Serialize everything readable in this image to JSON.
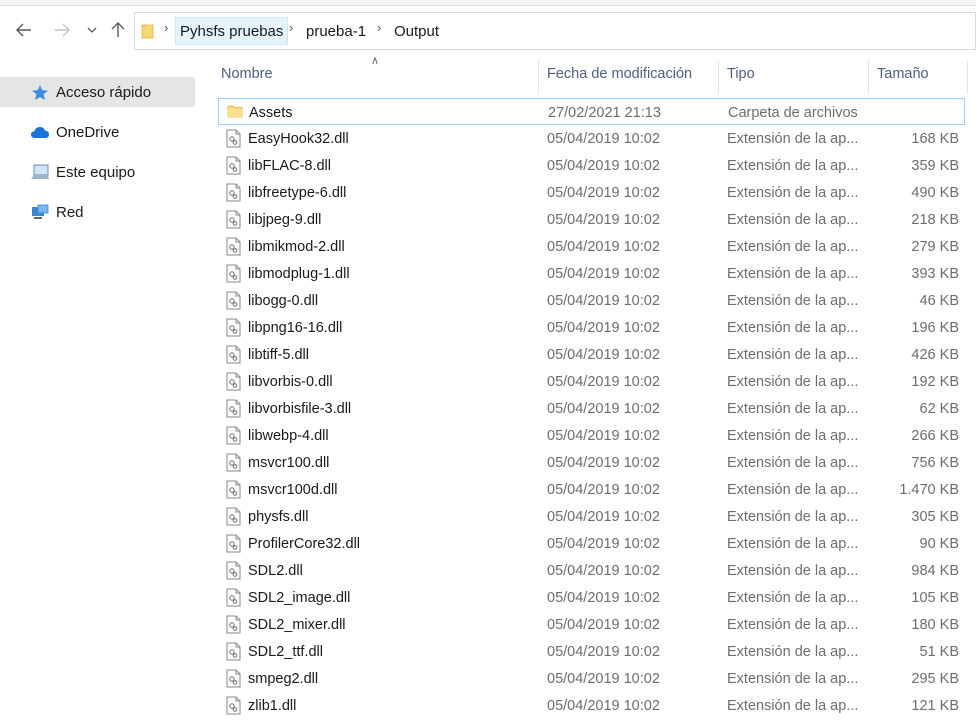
{
  "nav": {
    "back_icon": "back-arrow-icon",
    "forward_icon": "forward-arrow-icon",
    "recent_icon": "chevron-down-icon",
    "up_icon": "up-arrow-icon",
    "breadcrumbs": [
      "Pyhsfs pruebas",
      "prueba-1",
      "Output"
    ]
  },
  "sidebar": {
    "items": [
      {
        "label": "Acceso rápido",
        "icon": "star-icon"
      },
      {
        "label": "OneDrive",
        "icon": "cloud-icon"
      },
      {
        "label": "Este equipo",
        "icon": "computer-icon"
      },
      {
        "label": "Red",
        "icon": "network-icon"
      }
    ]
  },
  "columns": {
    "name": "Nombre",
    "date": "Fecha de modificación",
    "type": "Tipo",
    "size": "Tamaño"
  },
  "files": [
    {
      "name": "Assets",
      "date": "27/02/2021 21:13",
      "type": "Carpeta de archivos",
      "size": "",
      "kind": "folder"
    },
    {
      "name": "EasyHook32.dll",
      "date": "05/04/2019 10:02",
      "type": "Extensión de la ap...",
      "size": "168 KB",
      "kind": "dll"
    },
    {
      "name": "libFLAC-8.dll",
      "date": "05/04/2019 10:02",
      "type": "Extensión de la ap...",
      "size": "359 KB",
      "kind": "dll"
    },
    {
      "name": "libfreetype-6.dll",
      "date": "05/04/2019 10:02",
      "type": "Extensión de la ap...",
      "size": "490 KB",
      "kind": "dll"
    },
    {
      "name": "libjpeg-9.dll",
      "date": "05/04/2019 10:02",
      "type": "Extensión de la ap...",
      "size": "218 KB",
      "kind": "dll"
    },
    {
      "name": "libmikmod-2.dll",
      "date": "05/04/2019 10:02",
      "type": "Extensión de la ap...",
      "size": "279 KB",
      "kind": "dll"
    },
    {
      "name": "libmodplug-1.dll",
      "date": "05/04/2019 10:02",
      "type": "Extensión de la ap...",
      "size": "393 KB",
      "kind": "dll"
    },
    {
      "name": "libogg-0.dll",
      "date": "05/04/2019 10:02",
      "type": "Extensión de la ap...",
      "size": "46 KB",
      "kind": "dll"
    },
    {
      "name": "libpng16-16.dll",
      "date": "05/04/2019 10:02",
      "type": "Extensión de la ap...",
      "size": "196 KB",
      "kind": "dll"
    },
    {
      "name": "libtiff-5.dll",
      "date": "05/04/2019 10:02",
      "type": "Extensión de la ap...",
      "size": "426 KB",
      "kind": "dll"
    },
    {
      "name": "libvorbis-0.dll",
      "date": "05/04/2019 10:02",
      "type": "Extensión de la ap...",
      "size": "192 KB",
      "kind": "dll"
    },
    {
      "name": "libvorbisfile-3.dll",
      "date": "05/04/2019 10:02",
      "type": "Extensión de la ap...",
      "size": "62 KB",
      "kind": "dll"
    },
    {
      "name": "libwebp-4.dll",
      "date": "05/04/2019 10:02",
      "type": "Extensión de la ap...",
      "size": "266 KB",
      "kind": "dll"
    },
    {
      "name": "msvcr100.dll",
      "date": "05/04/2019 10:02",
      "type": "Extensión de la ap...",
      "size": "756 KB",
      "kind": "dll"
    },
    {
      "name": "msvcr100d.dll",
      "date": "05/04/2019 10:02",
      "type": "Extensión de la ap...",
      "size": "1.470 KB",
      "kind": "dll"
    },
    {
      "name": "physfs.dll",
      "date": "05/04/2019 10:02",
      "type": "Extensión de la ap...",
      "size": "305 KB",
      "kind": "dll"
    },
    {
      "name": "ProfilerCore32.dll",
      "date": "05/04/2019 10:02",
      "type": "Extensión de la ap...",
      "size": "90 KB",
      "kind": "dll"
    },
    {
      "name": "SDL2.dll",
      "date": "05/04/2019 10:02",
      "type": "Extensión de la ap...",
      "size": "984 KB",
      "kind": "dll"
    },
    {
      "name": "SDL2_image.dll",
      "date": "05/04/2019 10:02",
      "type": "Extensión de la ap...",
      "size": "105 KB",
      "kind": "dll"
    },
    {
      "name": "SDL2_mixer.dll",
      "date": "05/04/2019 10:02",
      "type": "Extensión de la ap...",
      "size": "180 KB",
      "kind": "dll"
    },
    {
      "name": "SDL2_ttf.dll",
      "date": "05/04/2019 10:02",
      "type": "Extensión de la ap...",
      "size": "51 KB",
      "kind": "dll"
    },
    {
      "name": "smpeg2.dll",
      "date": "05/04/2019 10:02",
      "type": "Extensión de la ap...",
      "size": "295 KB",
      "kind": "dll"
    },
    {
      "name": "zlib1.dll",
      "date": "05/04/2019 10:02",
      "type": "Extensión de la ap...",
      "size": "121 KB",
      "kind": "dll"
    }
  ],
  "colors": {
    "header_text": "#4d6082",
    "selected_border": "#99d1ff",
    "sidebar_active": "#e5e5e5",
    "folder_yellow": "#f8d775",
    "breadcrumb_selected": "#e5f3fb"
  }
}
